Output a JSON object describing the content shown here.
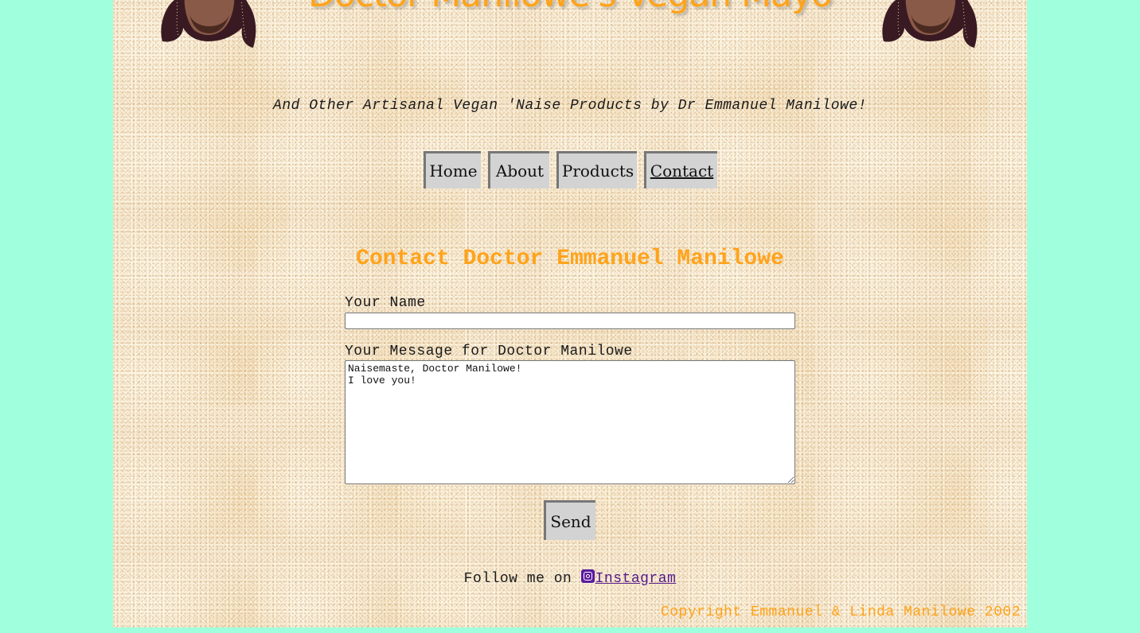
{
  "header": {
    "title": "Doctor Manilowe's Vegan Mayo",
    "tagline": "And Other Artisanal Vegan 'Naise Products by Dr Emmanuel Manilowe!"
  },
  "nav": {
    "items": [
      {
        "label": "Home",
        "active": false
      },
      {
        "label": "About",
        "active": false
      },
      {
        "label": "Products",
        "active": false
      },
      {
        "label": "Contact",
        "active": true
      }
    ]
  },
  "contact": {
    "heading": "Contact Doctor Emmanuel Manilowe",
    "name_label": "Your Name",
    "name_value": "",
    "message_label": "Your Message for Doctor Manilowe",
    "message_value": "Naisemaste, Doctor Manilowe!\nI love you!",
    "send_label": "Send"
  },
  "footer": {
    "follow_text": "Follow me on ",
    "instagram_label": "Instagram",
    "copyright": "Copyright Emmanuel & Linda Manilowe 2002"
  },
  "colors": {
    "page_background": "#a0ffdc",
    "accent_orange": "#ffa31a",
    "button_gray": "#d3d3d3",
    "link_purple": "#551a8b",
    "instagram_icon": "#5b1a9e"
  }
}
